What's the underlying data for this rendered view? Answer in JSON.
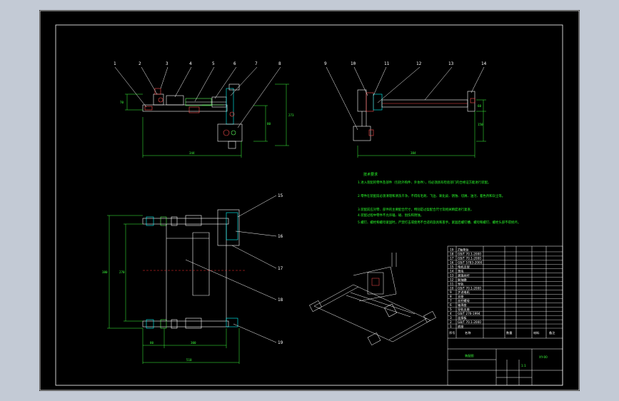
{
  "labels_left": [
    "1",
    "2",
    "3",
    "4",
    "5",
    "6",
    "7",
    "8"
  ],
  "labels_right": [
    "9",
    "10",
    "11",
    "12",
    "13",
    "14"
  ],
  "labels_plan": [
    "15",
    "16",
    "17",
    "18",
    "19"
  ],
  "dims": {
    "front_width": "344",
    "right_width": "384",
    "plan_width": "510",
    "plan_left_seg": "80",
    "plan_mid_seg": "300",
    "plan_height": "380",
    "plan_inner": "270",
    "front_h1": "70",
    "front_h2": "80",
    "front_h3": "273",
    "right_h1": "60",
    "right_h2": "150"
  },
  "notes": {
    "title": "技术要求",
    "lines": [
      "1.进入装配的零件及部件（包括外购件、外协件），均必须具有检验部门的合格证方能进行装配。",
      "2.零件在装配前必须清理和清洗干净，不得有毛刺、飞边、氧化皮、锈蚀、切屑、油污、着色剂和灰尘等。",
      "3.装配前应对零、部件的主要配合尺寸，特别是过盈配合尺寸及相关精度进行复查。",
      "4.装配过程中零件不允许磕、碰、划伤和锈蚀。",
      "5.螺钉、螺栓和螺母紧固时，严禁打击或使用不合适的旋具和扳手。紧固后螺钉槽、螺母和螺钉、螺栓头部不得损坏。"
    ]
  },
  "title_block": {
    "rows": [
      {
        "no": "19",
        "name": "Z轴滑台"
      },
      {
        "no": "18",
        "name": "GB/T 70.1-2000"
      },
      {
        "no": "17",
        "name": "GB/T 70.1-2000"
      },
      {
        "no": "16",
        "name": "GB/T 5783-2000"
      },
      {
        "no": "15",
        "name": "电机支架"
      },
      {
        "no": "14",
        "name": "滑块"
      },
      {
        "no": "13",
        "name": "滚珠丝杆"
      },
      {
        "no": "12",
        "name": "联轴器"
      },
      {
        "no": "11",
        "name": "导轨"
      },
      {
        "no": "10",
        "name": "GB/T 70.1-2000"
      },
      {
        "no": "9",
        "name": "步进电机"
      },
      {
        "no": "8",
        "name": "支座"
      },
      {
        "no": "7",
        "name": "丝杆螺母"
      },
      {
        "no": "6",
        "name": "轴承座"
      },
      {
        "no": "5",
        "name": "导轨支座"
      },
      {
        "no": "4",
        "name": "GB/T 276-1994"
      },
      {
        "no": "3",
        "name": "连接板"
      },
      {
        "no": "2",
        "name": "GB/T 70.1-2000"
      },
      {
        "no": "1",
        "name": "底座"
      }
    ],
    "header": {
      "no": "序号",
      "name": "名称",
      "qty": "数量",
      "material": "材料",
      "note": "备注"
    },
    "drawing_title": "装配图",
    "drawing_no": "XY-00",
    "scale": "1:1"
  }
}
